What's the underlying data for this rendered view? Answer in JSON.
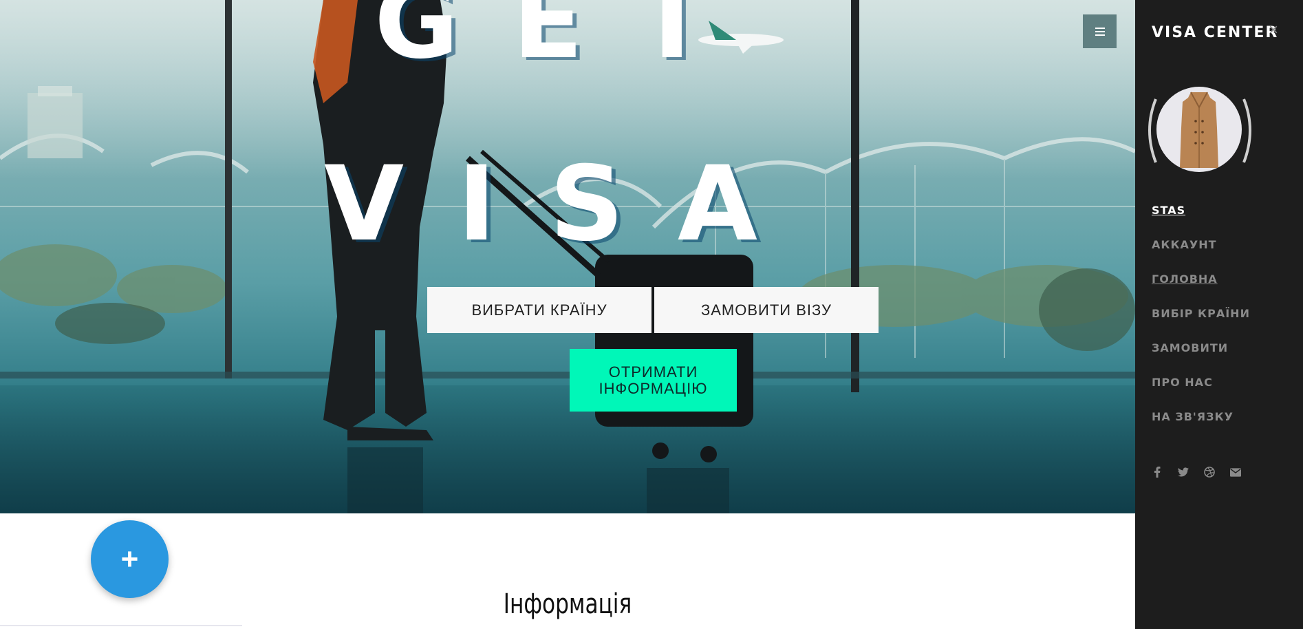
{
  "hero": {
    "title_top": "GET",
    "title_main": "VISA",
    "buttons": {
      "choose_country": "ВИБРАТИ КРАЇНУ",
      "order_visa": "ЗАМОВИТИ ВІЗУ"
    },
    "info_button": {
      "line1": "ОТРИМАТИ",
      "line2": "ІНФОРМАЦІЮ"
    },
    "menu_icon": "hamburger-icon"
  },
  "fab": {
    "label": "+"
  },
  "section": {
    "title": "Інформація"
  },
  "sidebar": {
    "brand": "VISA CENTER",
    "close": "×",
    "nav": {
      "user": "STAS",
      "account": "АККАУНТ",
      "home": "ГОЛОВНА",
      "country_choice": "ВИБІР КРАЇНИ",
      "order": "ЗАМОВИТИ",
      "about": "ПРО НАС",
      "contact": "НА ЗВ'ЯЗКУ"
    },
    "social_icons": [
      "facebook-icon",
      "twitter-icon",
      "dribbble-icon",
      "envelope-icon"
    ]
  },
  "colors": {
    "accent": "#00f7b8",
    "fab": "#2a98e0",
    "sidebar_bg": "#1d1d1d",
    "menu_toggle_bg": "#5f7f81"
  }
}
